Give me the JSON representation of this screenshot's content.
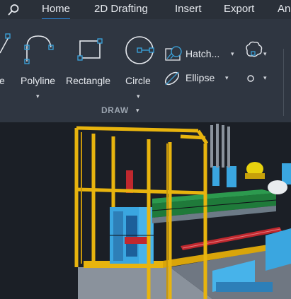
{
  "tabs": [
    {
      "label": "Home",
      "active": true
    },
    {
      "label": "2D Drafting",
      "active": false
    },
    {
      "label": "Insert",
      "active": false
    },
    {
      "label": "Export",
      "active": false
    },
    {
      "label": "An",
      "active": false
    }
  ],
  "ribbon": {
    "tools": {
      "partial_label": "e",
      "polyline": "Polyline",
      "rectangle": "Rectangle",
      "circle": "Circle",
      "hatch": "Hatch...",
      "ellipse": "Ellipse"
    },
    "group_label": "DRAW",
    "dropdown_glyph": "▾"
  },
  "colors": {
    "accent": "#2b86d9",
    "tabbar_bg": "#2a3039",
    "ribbon_bg": "#2f3641",
    "viewport_bg": "#1b1f26",
    "railing": "#e8b40e",
    "frame_blue": "#3aa6e0",
    "conveyor_green": "#1f7a3a",
    "machine_gray": "#8a929c",
    "red_part": "#c0282e"
  },
  "icons": [
    "search-icon",
    "polyline-icon",
    "rectangle-icon",
    "circle-icon",
    "hatch-icon",
    "ellipse-icon",
    "revcloud-icon",
    "point-icon",
    "chevron-down-icon"
  ]
}
